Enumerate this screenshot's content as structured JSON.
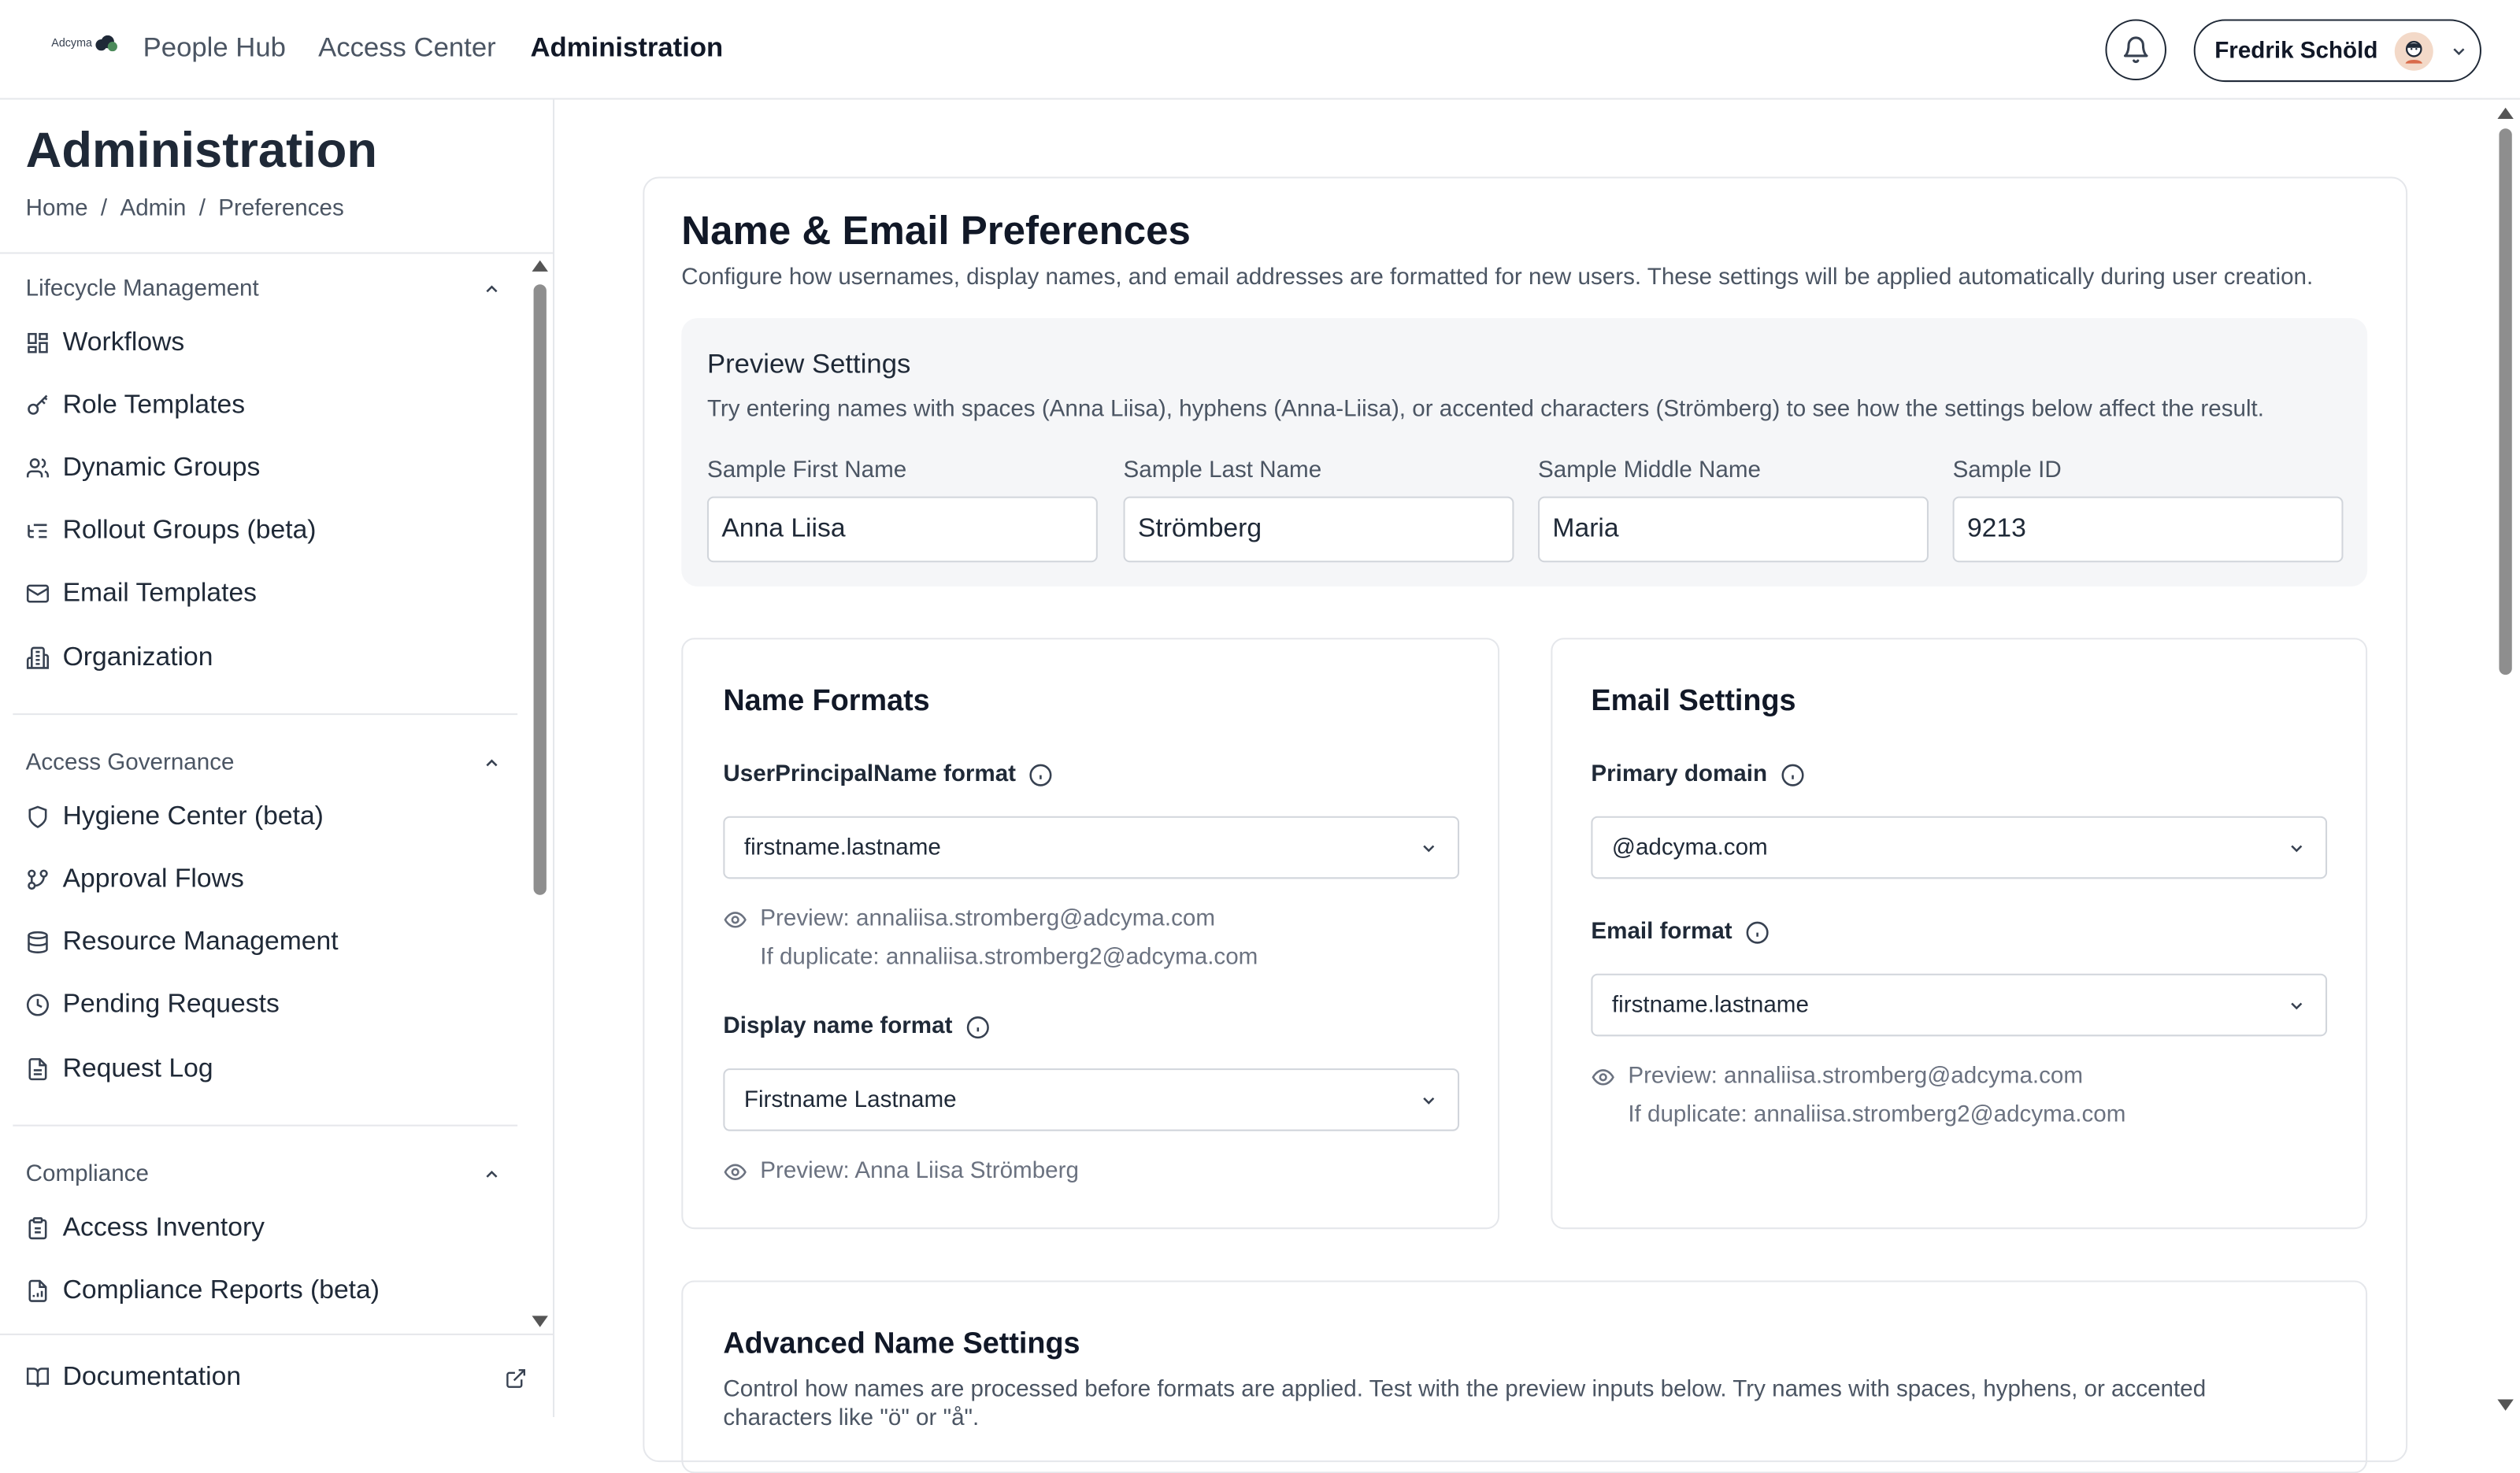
{
  "header": {
    "logo_text": "Adcyma",
    "nav": [
      "People Hub",
      "Access Center",
      "Administration"
    ],
    "user_name": "Fredrik Schöld"
  },
  "sidebar": {
    "title": "Administration",
    "breadcrumbs": [
      "Home",
      "/",
      "Admin",
      "/",
      "Preferences"
    ],
    "sections": [
      {
        "title": "Lifecycle Management",
        "items": [
          {
            "label": "Workflows",
            "icon": "grid-icon"
          },
          {
            "label": "Role Templates",
            "icon": "key-icon"
          },
          {
            "label": "Dynamic Groups",
            "icon": "users-icon"
          },
          {
            "label": "Rollout Groups (beta)",
            "icon": "list-tree-icon"
          },
          {
            "label": "Email Templates",
            "icon": "mail-icon"
          },
          {
            "label": "Organization",
            "icon": "building-icon"
          }
        ]
      },
      {
        "title": "Access Governance",
        "items": [
          {
            "label": "Hygiene Center (beta)",
            "icon": "shield-icon"
          },
          {
            "label": "Approval Flows",
            "icon": "git-branch-icon"
          },
          {
            "label": "Resource Management",
            "icon": "database-icon"
          },
          {
            "label": "Pending Requests",
            "icon": "clock-icon"
          },
          {
            "label": "Request Log",
            "icon": "file-text-icon"
          }
        ]
      },
      {
        "title": "Compliance",
        "items": [
          {
            "label": "Access Inventory",
            "icon": "clipboard-icon"
          },
          {
            "label": "Compliance Reports (beta)",
            "icon": "file-chart-icon"
          }
        ]
      }
    ],
    "documentation": "Documentation"
  },
  "main": {
    "title": "Name & Email Preferences",
    "description": "Configure how usernames, display names, and email addresses are formatted for new users. These settings will be applied automatically during user creation.",
    "preview": {
      "title": "Preview Settings",
      "description": "Try entering names with spaces (Anna Liisa), hyphens (Anna-Liisa), or accented characters (Strömberg) to see how the settings below affect the result.",
      "fields": [
        {
          "label": "Sample First Name",
          "value": "Anna Liisa"
        },
        {
          "label": "Sample Last Name",
          "value": "Strömberg"
        },
        {
          "label": "Sample Middle Name",
          "value": "Maria"
        },
        {
          "label": "Sample ID",
          "value": "9213"
        }
      ]
    },
    "name_formats": {
      "title": "Name Formats",
      "upn_label": "UserPrincipalName format",
      "upn_value": "firstname.lastname",
      "upn_preview": "Preview: annaliisa.stromberg@adcyma.com",
      "upn_duplicate": "If duplicate: annaliisa.stromberg2@adcyma.com",
      "display_label": "Display name format",
      "display_value": "Firstname Lastname",
      "display_preview": "Preview: Anna Liisa Strömberg"
    },
    "email_settings": {
      "title": "Email Settings",
      "domain_label": "Primary domain",
      "domain_value": "@adcyma.com",
      "format_label": "Email format",
      "format_value": "firstname.lastname",
      "preview": "Preview: annaliisa.stromberg@adcyma.com",
      "duplicate": "If duplicate: annaliisa.stromberg2@adcyma.com"
    },
    "advanced": {
      "title": "Advanced Name Settings",
      "description": "Control how names are processed before formats are applied. Test with the preview inputs below. Try names with spaces, hyphens, or accented",
      "description_2": "characters like \"ö\" or \"å\"."
    }
  }
}
